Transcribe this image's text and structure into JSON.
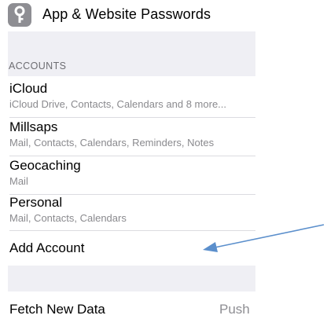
{
  "header": {
    "title": "App & Website Passwords",
    "icon": "key-icon"
  },
  "accounts_section": {
    "header": "ACCOUNTS",
    "items": [
      {
        "name": "iCloud",
        "detail": "iCloud Drive, Contacts, Calendars and 8 more..."
      },
      {
        "name": "Millsaps",
        "detail": "Mail, Contacts, Calendars, Reminders, Notes"
      },
      {
        "name": "Geocaching",
        "detail": "Mail"
      },
      {
        "name": "Personal",
        "detail": "Mail, Contacts, Calendars"
      }
    ],
    "add_label": "Add Account"
  },
  "fetch": {
    "label": "Fetch New Data",
    "value": "Push"
  },
  "colors": {
    "group_background": "#efeff4",
    "annotation_arrow": "#5b8fcc",
    "secondary_text": "#8e8e93"
  }
}
